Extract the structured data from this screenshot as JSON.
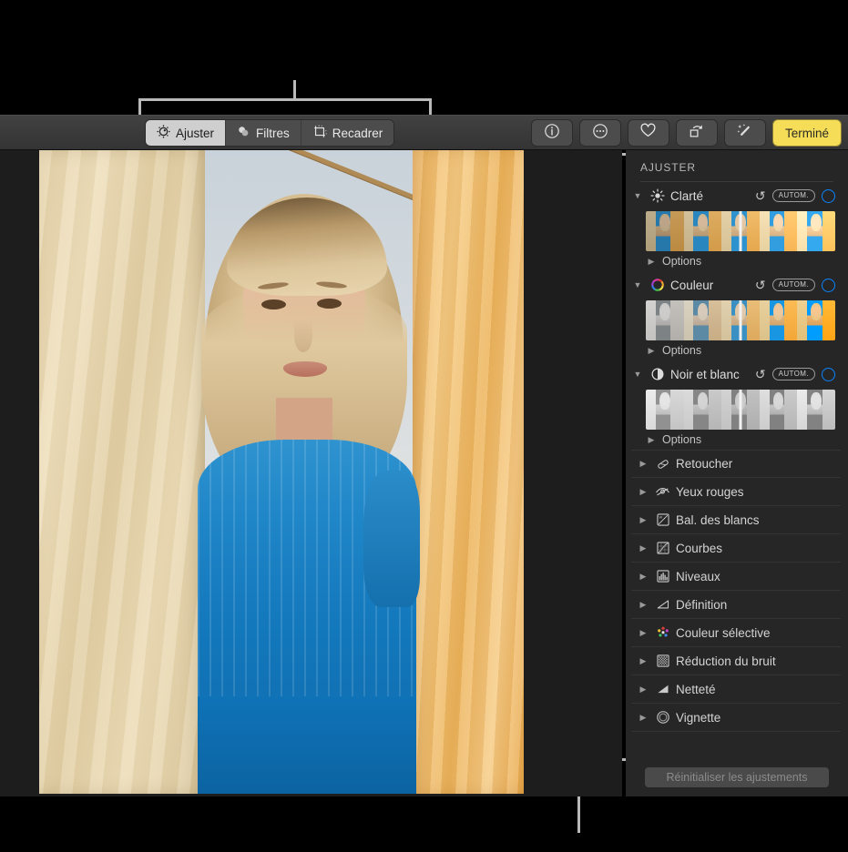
{
  "toolbar": {
    "segments": [
      {
        "label": "Ajuster",
        "icon": "adjust-dial-icon",
        "active": true
      },
      {
        "label": "Filtres",
        "icon": "filters-circles-icon",
        "active": false
      },
      {
        "label": "Recadrer",
        "icon": "crop-icon",
        "active": false
      }
    ],
    "right_buttons": [
      {
        "name": "info-button",
        "icon": "info-circle-icon"
      },
      {
        "name": "more-button",
        "icon": "ellipsis-circle-icon"
      },
      {
        "name": "favorite-button",
        "icon": "heart-icon"
      },
      {
        "name": "rotate-button",
        "icon": "rotate-icon"
      },
      {
        "name": "enhance-button",
        "icon": "magic-wand-icon"
      }
    ],
    "done_label": "Terminé"
  },
  "sidebar": {
    "title": "AJUSTER",
    "expanded": [
      {
        "label": "Clarté",
        "icon": "brightness-sun-icon",
        "revert": "↺",
        "auto": "AUTOM.",
        "options": "Options"
      },
      {
        "label": "Couleur",
        "icon": "color-wheel-icon",
        "revert": "↺",
        "auto": "AUTOM.",
        "options": "Options"
      },
      {
        "label": "Noir et blanc",
        "icon": "contrast-half-circle-icon",
        "revert": "↺",
        "auto": "AUTOM.",
        "options": "Options"
      }
    ],
    "collapsed": [
      {
        "label": "Retoucher",
        "icon": "bandage-retouch-icon"
      },
      {
        "label": "Yeux rouges",
        "icon": "eye-slash-icon"
      },
      {
        "label": "Bal. des blancs",
        "icon": "white-balance-icon"
      },
      {
        "label": "Courbes",
        "icon": "curves-icon"
      },
      {
        "label": "Niveaux",
        "icon": "levels-histogram-icon"
      },
      {
        "label": "Définition",
        "icon": "definition-triangle-icon"
      },
      {
        "label": "Couleur sélective",
        "icon": "selective-color-dots-icon"
      },
      {
        "label": "Réduction du bruit",
        "icon": "noise-reduction-icon"
      },
      {
        "label": "Netteté",
        "icon": "sharpness-triangle-icon"
      },
      {
        "label": "Vignette",
        "icon": "vignette-circle-icon"
      }
    ],
    "reset_label": "Réinitialiser les ajustements"
  },
  "colors": {
    "accent_blue": "#0a84ff",
    "done_yellow": "#f5dd58",
    "sidebar_bg": "#262626",
    "toolbar_bg": "#3a3a3a",
    "canvas_bg": "#1d1d1d",
    "callout": "#b9b9b9"
  },
  "photo": {
    "description": "Portrait d'une femme blonde en robe bleue entre des tissus suspendus",
    "disclosure_collapsed": "▶",
    "disclosure_expanded": "▼"
  }
}
